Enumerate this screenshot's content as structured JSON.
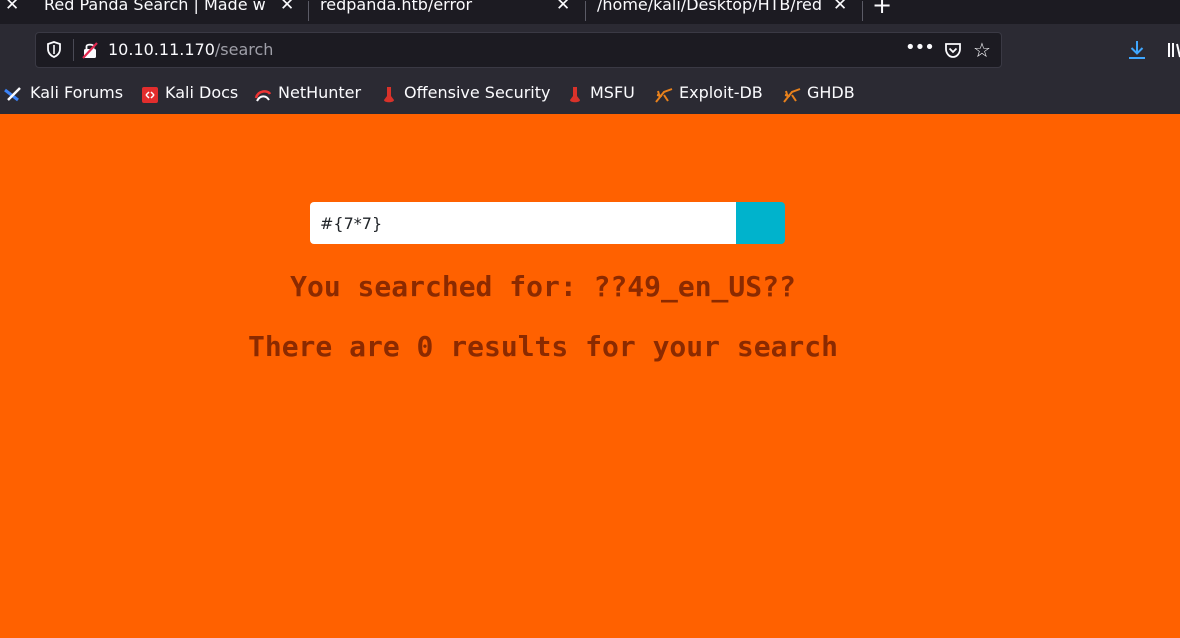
{
  "browser": {
    "tabs": [
      {
        "title": "Red Panda Search | Made with"
      },
      {
        "title": "redpanda.htb/error"
      },
      {
        "title": "/home/kali/Desktop/HTB/red"
      }
    ],
    "address": {
      "host": "10.10.11.170",
      "path": "/search"
    },
    "bookmarks": [
      {
        "label": "Kali Forums",
        "icon": "kali-forums-icon"
      },
      {
        "label": "Kali Docs",
        "icon": "kali-docs-icon"
      },
      {
        "label": "NetHunter",
        "icon": "nethunter-icon"
      },
      {
        "label": "Offensive Security",
        "icon": "offsec-icon"
      },
      {
        "label": "MSFU",
        "icon": "msfu-icon"
      },
      {
        "label": "Exploit-DB",
        "icon": "exploit-db-icon"
      },
      {
        "label": "GHDB",
        "icon": "ghdb-icon"
      }
    ],
    "colors": {
      "chrome": "#2b2a33",
      "tabstrip": "#1c1b22",
      "accent": "#00b3cc"
    }
  },
  "page": {
    "search_value": "#{7*7}",
    "searched_for": "You searched for: ??49_en_US??",
    "results": "There are 0 results for your search",
    "colors": {
      "background": "#ff6100",
      "text": "#8b2a00",
      "button": "#00b3cc"
    }
  }
}
